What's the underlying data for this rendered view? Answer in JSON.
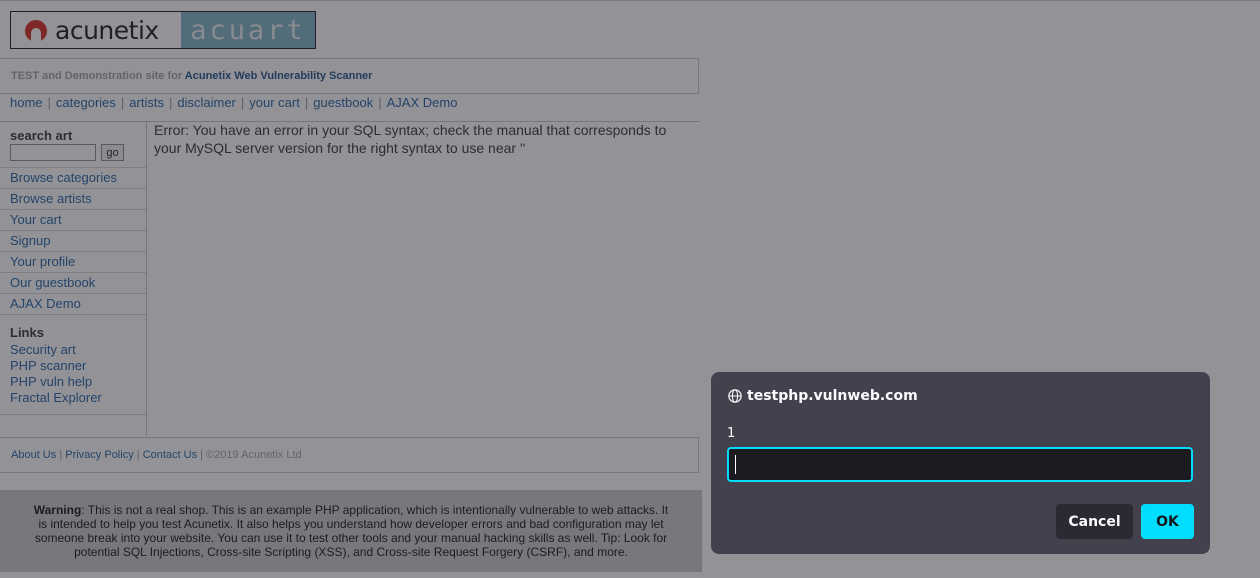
{
  "colors": {
    "link": "#1f5fa0",
    "overlay": "rgba(40,40,48,0.5)",
    "dialog_bg": "#42414d",
    "accent": "#00ddff"
  },
  "site": {
    "logo_left_text": "acunetix",
    "logo_right_text": "acuart",
    "tagline_prefix": "TEST and Demonstration site for",
    "tagline_link": "Acunetix Web Vulnerability Scanner",
    "nav": [
      "home",
      "categories",
      "artists",
      "disclaimer",
      "your cart",
      "guestbook",
      "AJAX Demo"
    ],
    "search_title": "search art",
    "search_button": "go",
    "menu": [
      "Browse categories",
      "Browse artists",
      "Your cart",
      "Signup",
      "Your profile",
      "Our guestbook",
      "AJAX Demo"
    ],
    "links_title": "Links",
    "links": [
      "Security art",
      "PHP scanner",
      "PHP vuln help",
      "Fractal Explorer"
    ],
    "error_text": "Error: You have an error in your SQL syntax; check the manual that corresponds to your MySQL server version for the right syntax to use near ''",
    "footer": {
      "about": "About Us",
      "privacy": "Privacy Policy",
      "contact": "Contact Us",
      "copyright": "©2019 Acunetix Ltd",
      "separator": "|"
    },
    "warning_label": "Warning",
    "warning_text": ": This is not a real shop. This is an example PHP application, which is intentionally vulnerable to web attacks. It is intended to help you test Acunetix. It also helps you understand how developer errors and bad configuration may let someone break into your website. You can use it to test other tools and your manual hacking skills as well. Tip: Look for potential SQL Injections, Cross-site Scripting (XSS), and Cross-site Request Forgery (CSRF), and more."
  },
  "dialog": {
    "origin": "testphp.vulnweb.com",
    "origin_icon": "globe-icon",
    "message": "1",
    "input_value": "",
    "cancel_label": "Cancel",
    "ok_label": "OK"
  }
}
